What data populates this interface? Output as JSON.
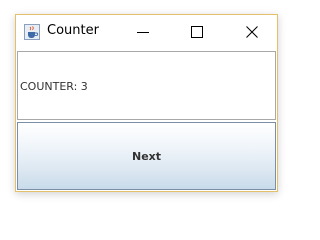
{
  "window": {
    "title": "Counter",
    "app_icon": "java-cup-icon",
    "controls": {
      "minimize_icon": "minimize-icon",
      "maximize_icon": "maximize-icon",
      "close_icon": "close-icon"
    }
  },
  "content": {
    "counter_label": "COUNTER: 3"
  },
  "actions": {
    "next_label": "Next"
  },
  "colors": {
    "window_border": "#e3c06a",
    "button_gradient_top": "#ffffff",
    "button_gradient_bottom": "#c9dbea",
    "text": "#333333"
  }
}
